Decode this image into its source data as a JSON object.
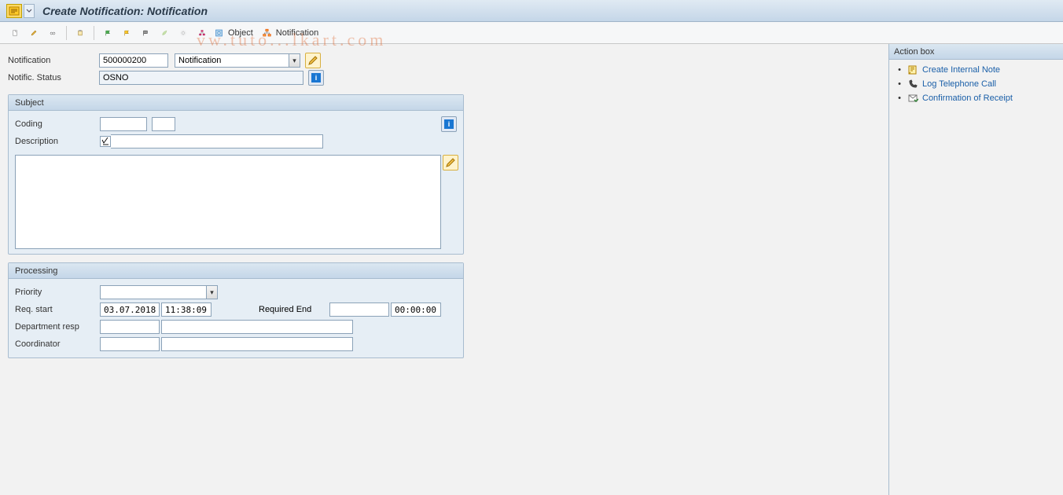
{
  "title": "Create Notification: Notification",
  "watermark": "vw.tuto...lkart.com",
  "toolbar": {
    "object_label": "Object",
    "notification_label": "Notification"
  },
  "header": {
    "notification_label": "Notification",
    "notification_value": "500000200",
    "notification_type_selected": "Notification",
    "status_label": "Notific. Status",
    "status_value": "OSNO"
  },
  "subject": {
    "group_title": "Subject",
    "coding_label": "Coding",
    "coding_value1": "",
    "coding_value2": "",
    "description_label": "Description",
    "description_value": "",
    "long_text": ""
  },
  "processing": {
    "group_title": "Processing",
    "priority_label": "Priority",
    "priority_selected": "",
    "req_start_label": "Req. start",
    "req_start_date": "03.07.2018",
    "req_start_time": "11:38:09",
    "required_end_label": "Required End",
    "required_end_date": "",
    "required_end_time": "00:00:00",
    "dept_resp_label": "Department resp",
    "dept_resp_value1": "",
    "dept_resp_value2": "",
    "coord_label": "Coordinator",
    "coord_value1": "",
    "coord_value2": ""
  },
  "action_box": {
    "title": "Action box",
    "items": [
      {
        "icon": "note-icon",
        "label": "Create Internal Note"
      },
      {
        "icon": "phone-icon",
        "label": "Log Telephone Call"
      },
      {
        "icon": "receipt-icon",
        "label": "Confirmation of Receipt"
      }
    ]
  }
}
